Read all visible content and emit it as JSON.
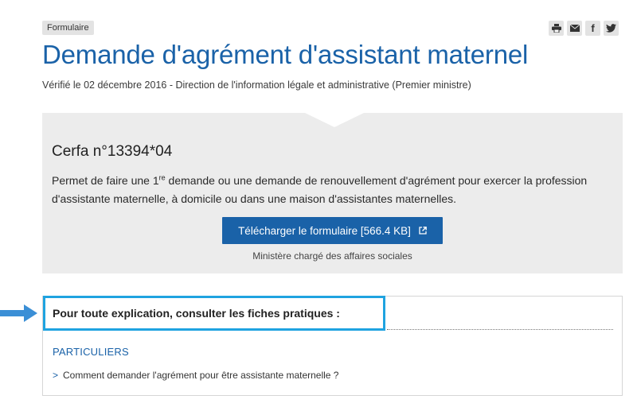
{
  "tag": "Formulaire",
  "share": {
    "icons": [
      "print-icon",
      "mail-icon",
      "facebook-icon",
      "twitter-icon"
    ],
    "facebook_glyph": "f"
  },
  "title": "Demande d'agrément d'assistant maternel",
  "meta": "Vérifié le 02 décembre 2016 - Direction de l'information légale et administrative (Premier ministre)",
  "form": {
    "cerfa": "Cerfa n°13394*04",
    "desc_pre": "Permet de faire une 1",
    "desc_sup": "re",
    "desc_post": " demande ou une demande de renouvellement d'agrément pour exercer la profession d'assistante maternelle, à domicile ou dans une maison d'assistantes maternelles.",
    "download_label": "Télécharger le formulaire [566.4 KB]",
    "ministry": "Ministère chargé des affaires sociales"
  },
  "explain": {
    "title": "Pour toute explication, consulter les fiches pratiques :",
    "category": "PARTICULIERS",
    "chevron": ">",
    "link": "Comment demander l'agrément pour être assistante maternelle ?"
  },
  "colors": {
    "accent": "#1a62a8",
    "highlight": "#1fa3e0",
    "panel_bg": "#ececec",
    "tag_bg": "#e3e3e3",
    "arrow": "#3b8fd6"
  }
}
